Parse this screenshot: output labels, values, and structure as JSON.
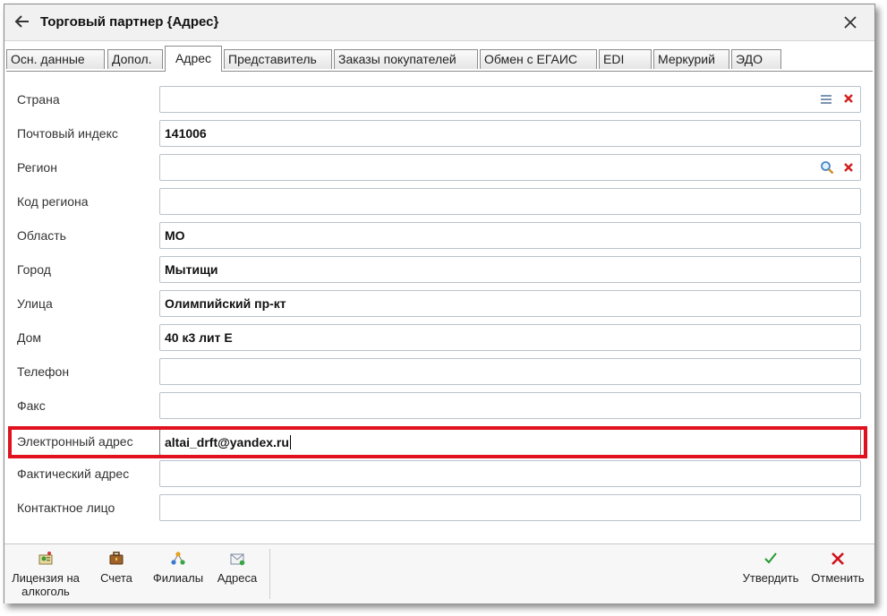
{
  "window": {
    "title": "Торговый партнер {Адрес}",
    "icons": {
      "back": "arrow-left-icon",
      "close": "close-icon"
    }
  },
  "tabs": [
    {
      "label": "Осн. данные",
      "active": false
    },
    {
      "label": "Допол.",
      "active": false
    },
    {
      "label": "Адрес",
      "active": true
    },
    {
      "label": "Представитель",
      "active": false
    },
    {
      "label": "Заказы покупателей",
      "active": false
    },
    {
      "label": "Обмен с ЕГАИС",
      "active": false
    },
    {
      "label": "EDI",
      "active": false
    },
    {
      "label": "Меркурий",
      "active": false
    },
    {
      "label": "ЭДО",
      "active": false
    }
  ],
  "form": {
    "fields": [
      {
        "label": "Страна",
        "value": "",
        "icons": [
          "list-icon",
          "clear-icon"
        ]
      },
      {
        "label": "Почтовый индекс",
        "value": "141006"
      },
      {
        "label": "Регион",
        "value": "",
        "icons": [
          "search-icon",
          "clear-icon"
        ]
      },
      {
        "label": "Код региона",
        "value": ""
      },
      {
        "label": "Область",
        "value": "МО"
      },
      {
        "label": "Город",
        "value": "Мытищи"
      },
      {
        "label": "Улица",
        "value": "Олимпийский пр-кт"
      },
      {
        "label": "Дом",
        "value": "40 к3 лит Е"
      },
      {
        "label": "Телефон",
        "value": ""
      },
      {
        "label": "Факс",
        "value": ""
      },
      {
        "label": "Электронный адрес",
        "value": "altai_drft@yandex.ru",
        "highlighted": true,
        "focused": true
      },
      {
        "label": "Фактический адрес",
        "value": ""
      },
      {
        "label": "Контактное лицо",
        "value": ""
      }
    ],
    "highlight_color": "#e0121f"
  },
  "toolbar": {
    "left": [
      {
        "label": "Лицензия на алкоголь",
        "icon": "license-icon"
      },
      {
        "label": "Счета",
        "icon": "briefcase-icon"
      },
      {
        "label": "Филиалы",
        "icon": "branches-icon"
      },
      {
        "label": "Адреса",
        "icon": "envelope-icon"
      }
    ],
    "right": [
      {
        "label": "Утвердить",
        "icon": "checkmark-icon",
        "color": "#1f9a2e"
      },
      {
        "label": "Отменить",
        "icon": "cancel-icon",
        "color": "#d0101a"
      }
    ]
  }
}
